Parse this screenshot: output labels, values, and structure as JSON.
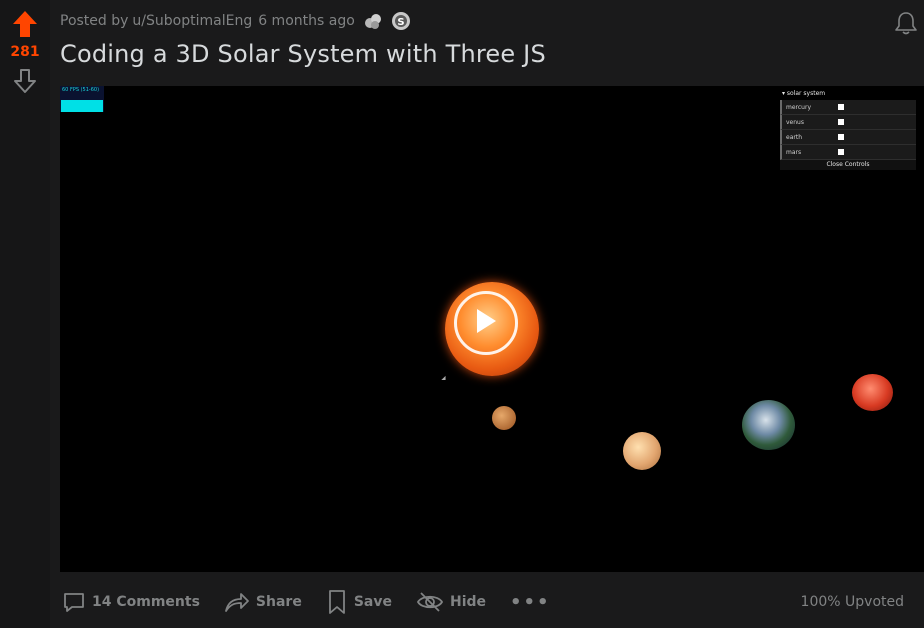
{
  "vote": {
    "score": "281"
  },
  "post": {
    "posted_by_prefix": "Posted by",
    "author": "u/SuboptimalEng",
    "time": "6 months ago",
    "title": "Coding a 3D Solar System with Three JS"
  },
  "media": {
    "fps_readout": "60 FPS (51-60)",
    "gui": {
      "title": "▾ solar system",
      "rows": [
        {
          "label": "mercury"
        },
        {
          "label": "venus"
        },
        {
          "label": "earth"
        },
        {
          "label": "mars"
        }
      ],
      "close_label": "Close Controls"
    }
  },
  "actions": {
    "comments": "14 Comments",
    "share": "Share",
    "save": "Save",
    "hide": "Hide",
    "more": "•••",
    "upvoted": "100% Upvoted"
  },
  "colors": {
    "accent": "#ff4500",
    "background": "#1a1a1b",
    "text_muted": "#818384",
    "title": "#d7dadc"
  }
}
